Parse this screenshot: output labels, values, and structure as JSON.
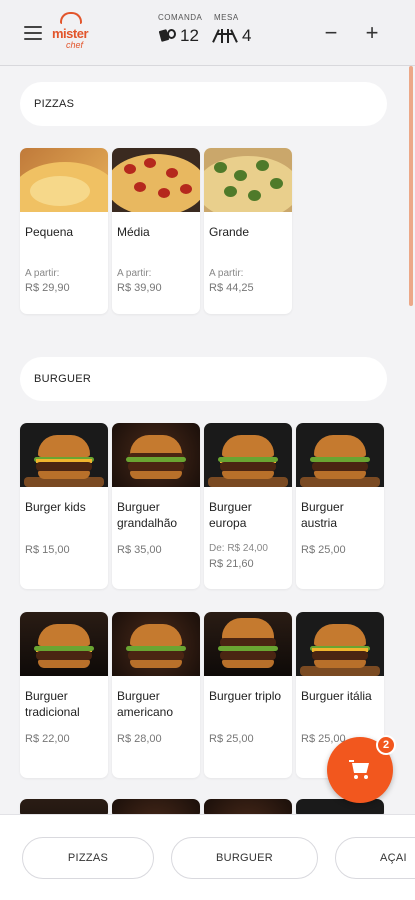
{
  "header": {
    "logo_text": "mister",
    "logo_subtext": "chef",
    "comanda_label": "COMANDA",
    "comanda_value": "12",
    "mesa_label": "MESA",
    "mesa_value": "4",
    "minus_label": "−",
    "plus_label": "+"
  },
  "sections": {
    "pizzas": {
      "title": "PIZZAS",
      "items": [
        {
          "name": "Pequena",
          "prefix": "A partir:",
          "price": "R$ 29,90"
        },
        {
          "name": "Média",
          "prefix": "A partir:",
          "price": "R$ 39,90"
        },
        {
          "name": "Grande",
          "prefix": "A partir:",
          "price": "R$ 44,25"
        }
      ]
    },
    "burguer": {
      "title": "BURGUER",
      "items": [
        {
          "name": "Burger kids",
          "price": "R$ 15,00"
        },
        {
          "name": "Burguer grandalhão",
          "price": "R$ 35,00"
        },
        {
          "name": "Burguer europa",
          "old_price": "De: R$ 24,00",
          "price": "R$ 21,60"
        },
        {
          "name": "Burguer austria",
          "price": "R$ 25,00"
        },
        {
          "name": "Burguer tradicional",
          "price": "R$ 22,00"
        },
        {
          "name": "Burguer americano",
          "price": "R$ 28,00"
        },
        {
          "name": "Burguer triplo",
          "price": "R$ 25,00"
        },
        {
          "name": "Burguer itália",
          "price": "R$ 25,00"
        }
      ]
    }
  },
  "cart": {
    "count": "2"
  },
  "categories": [
    "PIZZAS",
    "BURGUER",
    "AÇAI"
  ],
  "colors": {
    "accent": "#f2571e",
    "background": "#f3f3f5",
    "card": "#ffffff"
  }
}
